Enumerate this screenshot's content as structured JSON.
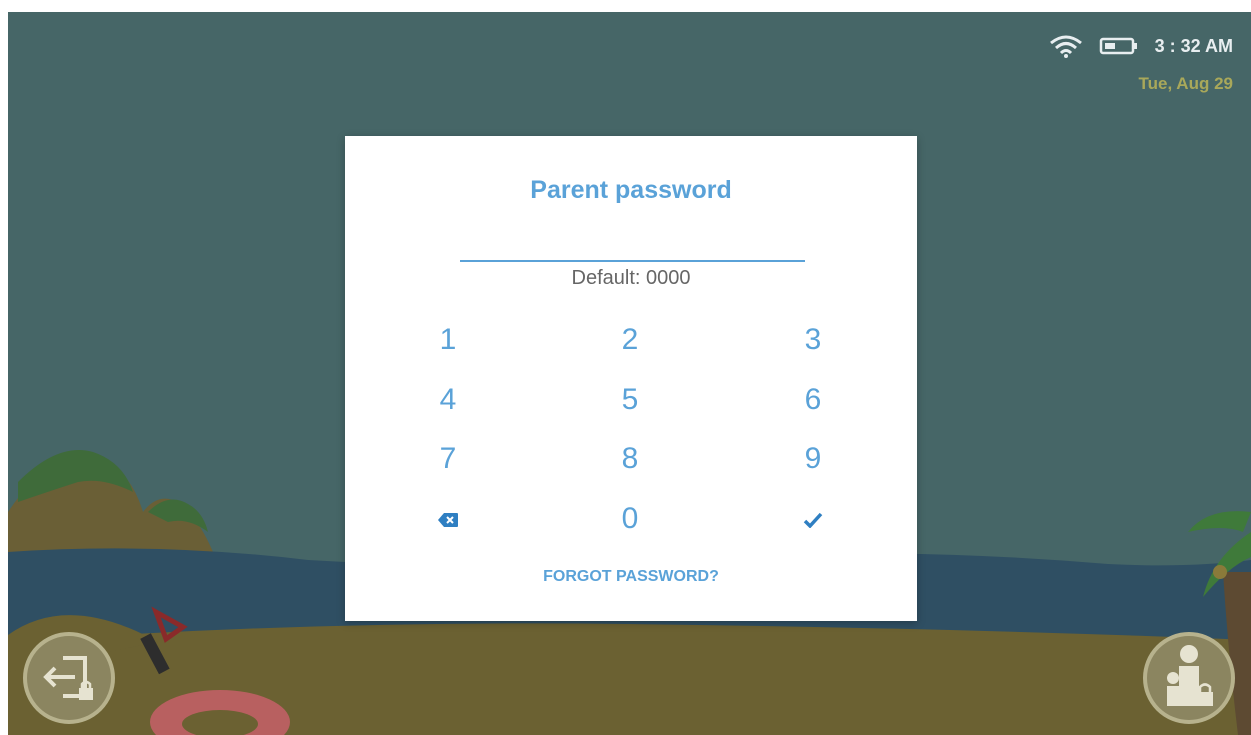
{
  "status_bar": {
    "time": "3 : 32 AM",
    "date": "Tue, Aug 29",
    "wifi_icon": "wifi-icon",
    "battery_icon": "battery-icon"
  },
  "dialog": {
    "title": "Parent password",
    "password_value": "",
    "hint": "Default: 0000",
    "keypad": [
      "1",
      "2",
      "3",
      "4",
      "5",
      "6",
      "7",
      "8",
      "9",
      "0"
    ],
    "backspace_icon": "backspace-icon",
    "confirm_icon": "check-icon",
    "forgot_label": "FORGOT PASSWORD?"
  },
  "bottom_buttons": {
    "exit_icon": "exit-lock-icon",
    "parent_icon": "parent-lock-icon"
  },
  "colors": {
    "accent": "#5aa2d8",
    "sky": "#456566",
    "sea": "#2f4f63",
    "sand": "#6b6132"
  }
}
